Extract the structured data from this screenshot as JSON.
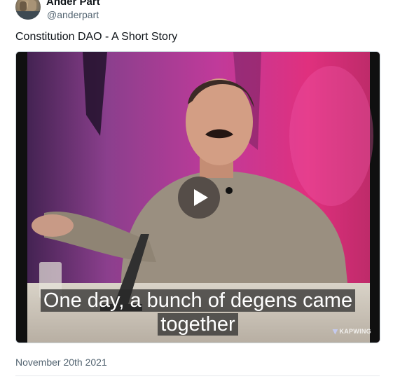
{
  "author": {
    "name": "Ander Part",
    "handle": "@anderpart",
    "avatar_icon": "avatar-photo"
  },
  "tweet": {
    "text": "Constitution DAO - A Short Story",
    "timestamp": "November 20th 2021"
  },
  "video": {
    "subtitle_line1": "One day, a bunch of degens came",
    "subtitle_line2": "together",
    "watermark": "KAPWING",
    "play_icon": "play-icon"
  }
}
